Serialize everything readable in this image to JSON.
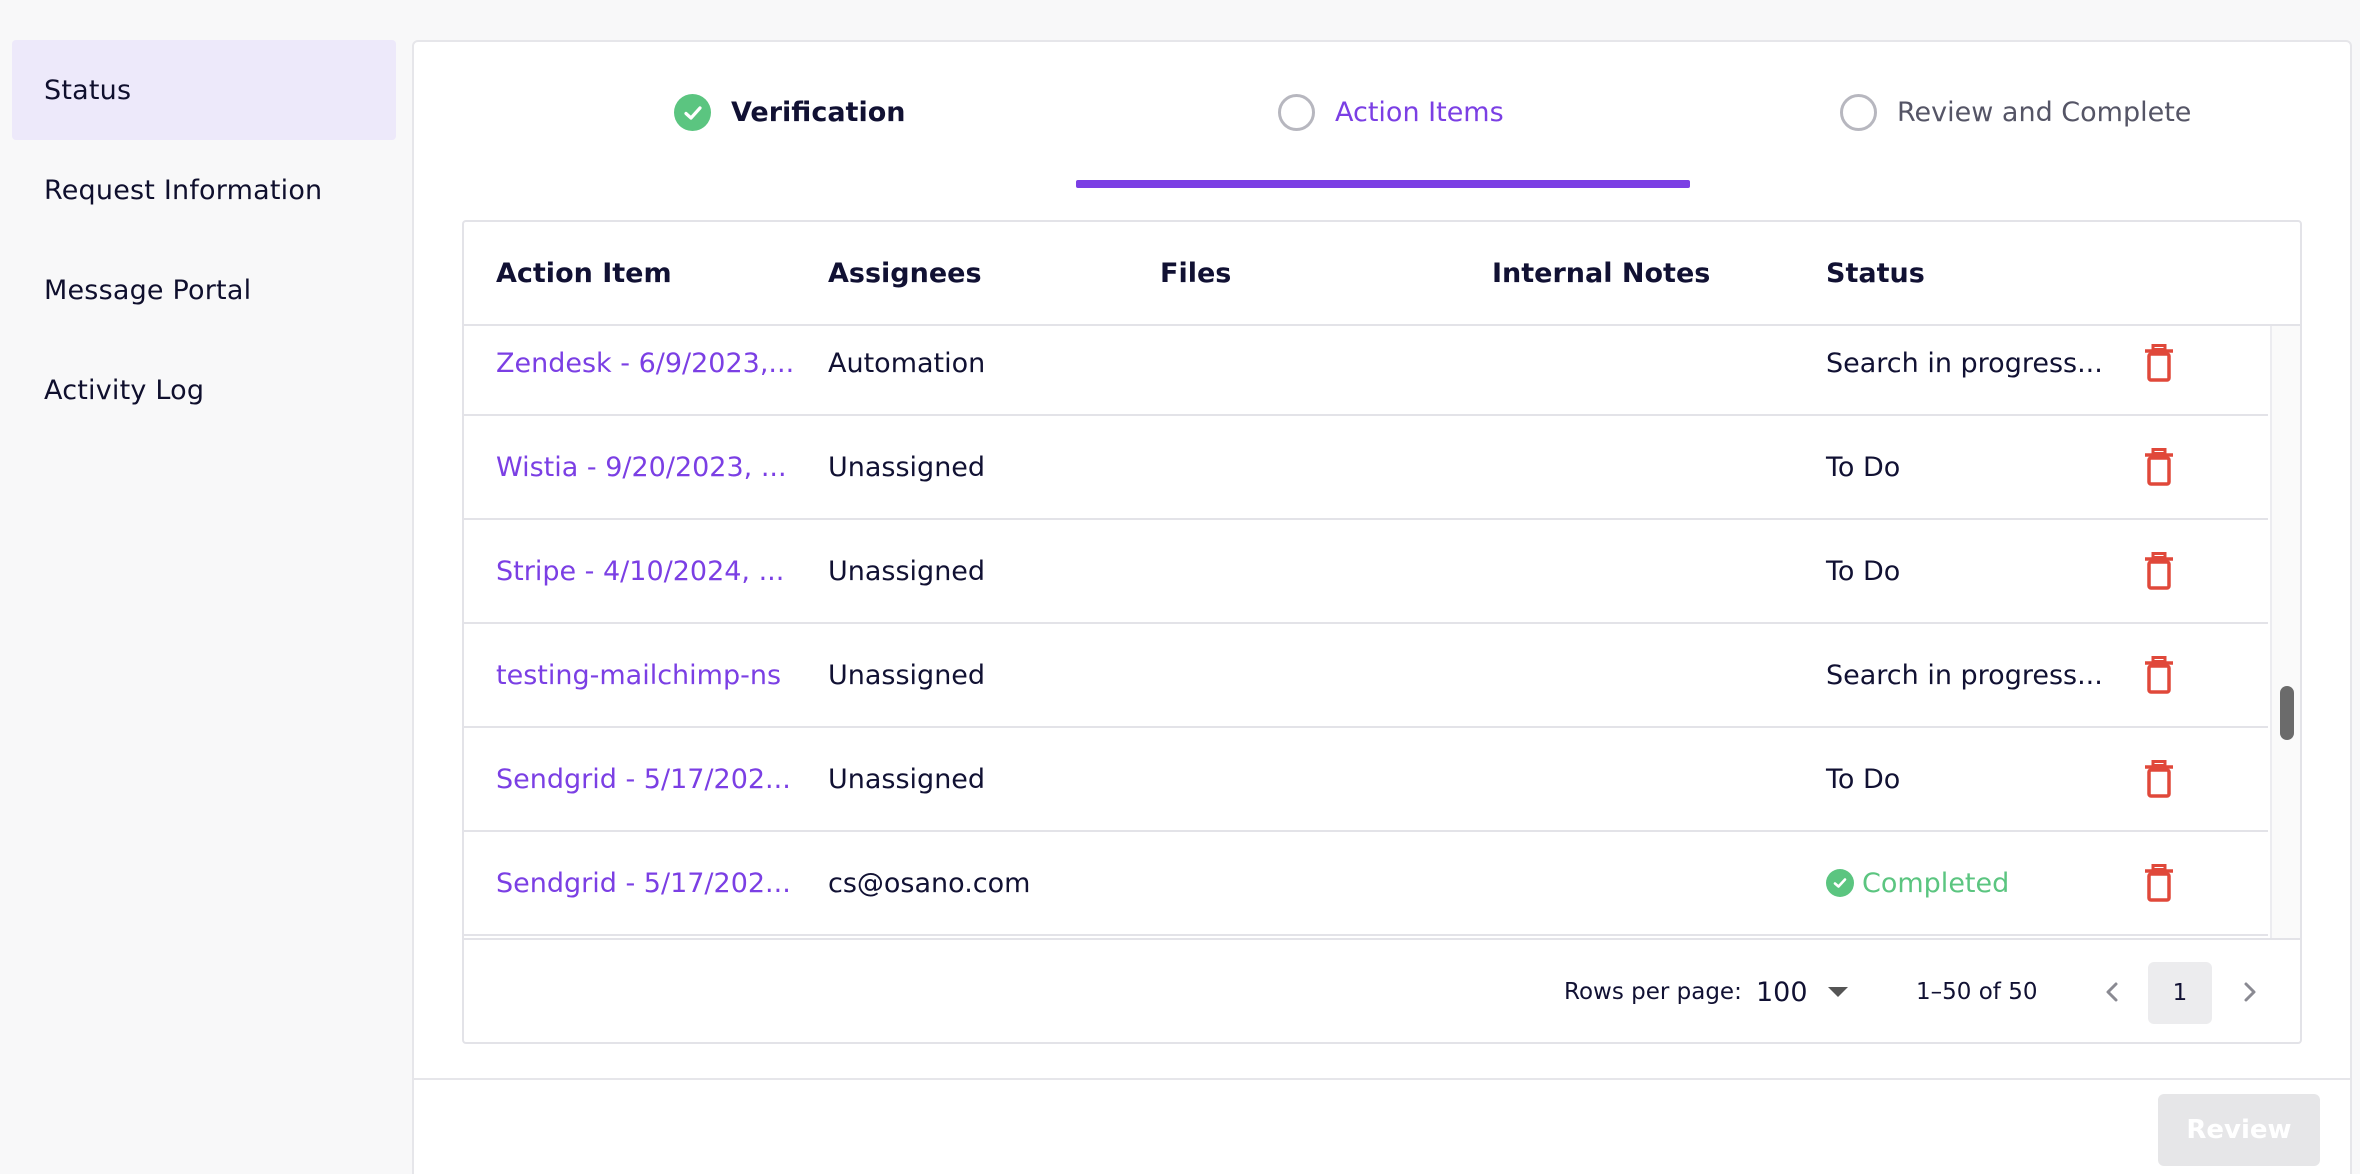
{
  "sidebar": {
    "items": [
      {
        "label": "Status",
        "active": true
      },
      {
        "label": "Request Information"
      },
      {
        "label": "Message Portal"
      },
      {
        "label": "Activity Log"
      }
    ]
  },
  "stepper": {
    "steps": [
      {
        "label": "Verification",
        "state": "complete"
      },
      {
        "label": "Action Items",
        "state": "active"
      },
      {
        "label": "Review and Complete",
        "state": "pending"
      }
    ]
  },
  "table": {
    "headers": [
      "Action Item",
      "Assignees",
      "Files",
      "Internal Notes",
      "Status"
    ],
    "rows": [
      {
        "item": "Zendesk - 6/9/2023,...",
        "assignee": "Automation",
        "status": "Search in progress..."
      },
      {
        "item": "Wistia - 9/20/2023, ...",
        "assignee": "Unassigned",
        "status": "To Do"
      },
      {
        "item": "Stripe - 4/10/2024, ...",
        "assignee": "Unassigned",
        "status": "To Do"
      },
      {
        "item": "testing-mailchimp-ns",
        "assignee": "Unassigned",
        "status": "Search in progress..."
      },
      {
        "item": "Sendgrid - 5/17/202...",
        "assignee": "Unassigned",
        "status": "To Do"
      },
      {
        "item": "Sendgrid - 5/17/202...",
        "assignee": "cs@osano.com",
        "status": "Completed"
      }
    ]
  },
  "pagination": {
    "rows_per_page_label": "Rows per page:",
    "rows_per_page": "100",
    "range": "1–50 of 50",
    "current_page": "1"
  },
  "footer": {
    "review_label": "Review"
  },
  "colors": {
    "accent": "#7b3fe4",
    "success": "#5bc580",
    "danger": "#e0483a",
    "sidebar_active_bg": "#ede9fa"
  },
  "icons": {
    "step_complete": "check-circle-icon",
    "step_pending": "circle-outline-icon",
    "delete": "trash-icon",
    "completed_status": "check-circle-icon",
    "dropdown": "caret-down-icon",
    "prev": "chevron-left-icon",
    "next": "chevron-right-icon"
  }
}
